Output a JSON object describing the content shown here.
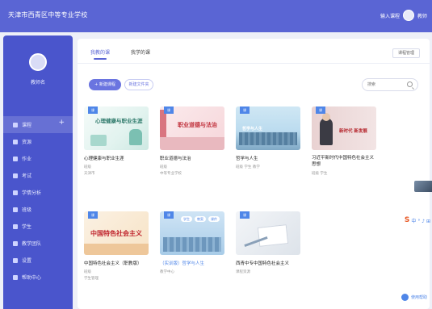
{
  "header": {
    "title": "天津市西青区中等专业学校",
    "right_link": "输入课程",
    "user_label": "教师"
  },
  "sidebar": {
    "user_name": "教师名",
    "items": [
      {
        "label": "课程",
        "icon": "book-icon",
        "active": true
      },
      {
        "label": "资源",
        "icon": "pin-icon"
      },
      {
        "label": "作业",
        "icon": "clipboard-icon"
      },
      {
        "label": "考试",
        "icon": "list-icon"
      },
      {
        "label": "学情分析",
        "icon": "cross-icon"
      },
      {
        "label": "班级",
        "icon": "location-icon"
      },
      {
        "label": "学生",
        "icon": "person-icon"
      },
      {
        "label": "教学团队",
        "icon": "team-icon"
      },
      {
        "label": "设置",
        "icon": "home-icon"
      },
      {
        "label": "帮助中心",
        "icon": "help-icon"
      }
    ]
  },
  "main": {
    "tabs": [
      {
        "label": "我教的课",
        "active": true
      },
      {
        "label": "我学的课",
        "active": false
      }
    ],
    "settings_button": "课程管理",
    "new_course_button": "+ 新建课程",
    "new_folder_button": "新建文件夹",
    "search_placeholder": "搜索",
    "courses": [
      {
        "thumb_caption": "心理健康与职业生涯",
        "title": "心理健康与职业生涯",
        "line1": "班级",
        "line2": "天津市",
        "corner": "课"
      },
      {
        "thumb_caption": "职业道德与法治",
        "title": "职业道德与法治",
        "line1": "班级",
        "line2": "中等专业学校",
        "corner": "课"
      },
      {
        "thumb_caption": "哲学与人生",
        "title": "哲学与人生",
        "line1": "班级  学生  教学",
        "line2": "",
        "corner": "课"
      },
      {
        "thumb_caption": "新时代 新发展",
        "title": "习近平新时代中国特色社会主义思想",
        "line1": "班级  学生",
        "line2": "",
        "corner": "课"
      },
      {
        "thumb_caption": "中国特色社会主义",
        "title": "中国特色社会主义（职教版）",
        "line1": "班级",
        "line2": "学生管理",
        "corner": "课"
      },
      {
        "thumb_caption": "",
        "title": "（实训版）哲学与人生",
        "line1": "教学中心",
        "line2": "",
        "corner": "课",
        "pills": [
          "学生",
          "教案",
          "课件"
        ]
      },
      {
        "thumb_caption": "",
        "title": "西青中专中国特色社会主义",
        "line1": "课程资源",
        "line2": "",
        "corner": "课"
      }
    ]
  },
  "widgets": {
    "ime_text": "中 ° ♪ ⊞",
    "help_label": "使用帮助"
  },
  "colors": {
    "header": "#5a65d4",
    "sidebar": "#4a55cc",
    "accent": "#6a74e0",
    "badge": "#4f86e8"
  }
}
